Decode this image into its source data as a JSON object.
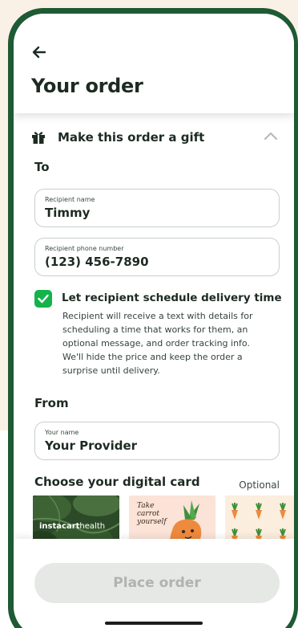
{
  "header": {
    "title": "Your order"
  },
  "gift": {
    "label": "Make this order a gift",
    "to_label": "To",
    "recipient_name": {
      "label": "Recipient name",
      "value": "Timmy"
    },
    "recipient_phone": {
      "label": "Recipient phone number",
      "value": "(123) 456-7890"
    },
    "schedule": {
      "checked": true,
      "title": "Let recipient schedule delivery time",
      "description": "Recipient will receive a text with details for scheduling a time that works for them, an optional message, and order tracking info. We'll hide the price and keep the order a surprise until delivery."
    },
    "from_label": "From",
    "your_name": {
      "label": "Your name",
      "value": "Your Provider"
    }
  },
  "digital_card": {
    "title": "Choose your digital card",
    "optional": "Optional",
    "cards": [
      {
        "brand_a": "instacart",
        "brand_b": "health"
      },
      {
        "text": "Take carrot yourself"
      },
      {
        "pattern": "carrots"
      }
    ]
  },
  "footer": {
    "place_order": "Place order"
  },
  "colors": {
    "brand_green": "#1e5a34",
    "check_green": "#14b34a",
    "text_dark": "#1d2b22",
    "disabled_button": "#e6e8e6"
  }
}
